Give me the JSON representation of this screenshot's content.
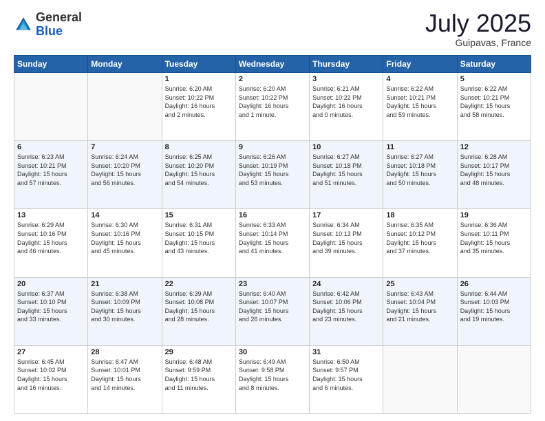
{
  "header": {
    "logo_general": "General",
    "logo_blue": "Blue",
    "month": "July 2025",
    "location": "Guipavas, France"
  },
  "weekdays": [
    "Sunday",
    "Monday",
    "Tuesday",
    "Wednesday",
    "Thursday",
    "Friday",
    "Saturday"
  ],
  "weeks": [
    [
      {
        "day": "",
        "info": ""
      },
      {
        "day": "",
        "info": ""
      },
      {
        "day": "1",
        "info": "Sunrise: 6:20 AM\nSunset: 10:22 PM\nDaylight: 16 hours\nand 2 minutes."
      },
      {
        "day": "2",
        "info": "Sunrise: 6:20 AM\nSunset: 10:22 PM\nDaylight: 16 hours\nand 1 minute."
      },
      {
        "day": "3",
        "info": "Sunrise: 6:21 AM\nSunset: 10:22 PM\nDaylight: 16 hours\nand 0 minutes."
      },
      {
        "day": "4",
        "info": "Sunrise: 6:22 AM\nSunset: 10:21 PM\nDaylight: 15 hours\nand 59 minutes."
      },
      {
        "day": "5",
        "info": "Sunrise: 6:22 AM\nSunset: 10:21 PM\nDaylight: 15 hours\nand 58 minutes."
      }
    ],
    [
      {
        "day": "6",
        "info": "Sunrise: 6:23 AM\nSunset: 10:21 PM\nDaylight: 15 hours\nand 57 minutes."
      },
      {
        "day": "7",
        "info": "Sunrise: 6:24 AM\nSunset: 10:20 PM\nDaylight: 15 hours\nand 56 minutes."
      },
      {
        "day": "8",
        "info": "Sunrise: 6:25 AM\nSunset: 10:20 PM\nDaylight: 15 hours\nand 54 minutes."
      },
      {
        "day": "9",
        "info": "Sunrise: 6:26 AM\nSunset: 10:19 PM\nDaylight: 15 hours\nand 53 minutes."
      },
      {
        "day": "10",
        "info": "Sunrise: 6:27 AM\nSunset: 10:18 PM\nDaylight: 15 hours\nand 51 minutes."
      },
      {
        "day": "11",
        "info": "Sunrise: 6:27 AM\nSunset: 10:18 PM\nDaylight: 15 hours\nand 50 minutes."
      },
      {
        "day": "12",
        "info": "Sunrise: 6:28 AM\nSunset: 10:17 PM\nDaylight: 15 hours\nand 48 minutes."
      }
    ],
    [
      {
        "day": "13",
        "info": "Sunrise: 6:29 AM\nSunset: 10:16 PM\nDaylight: 15 hours\nand 46 minutes."
      },
      {
        "day": "14",
        "info": "Sunrise: 6:30 AM\nSunset: 10:16 PM\nDaylight: 15 hours\nand 45 minutes."
      },
      {
        "day": "15",
        "info": "Sunrise: 6:31 AM\nSunset: 10:15 PM\nDaylight: 15 hours\nand 43 minutes."
      },
      {
        "day": "16",
        "info": "Sunrise: 6:33 AM\nSunset: 10:14 PM\nDaylight: 15 hours\nand 41 minutes."
      },
      {
        "day": "17",
        "info": "Sunrise: 6:34 AM\nSunset: 10:13 PM\nDaylight: 15 hours\nand 39 minutes."
      },
      {
        "day": "18",
        "info": "Sunrise: 6:35 AM\nSunset: 10:12 PM\nDaylight: 15 hours\nand 37 minutes."
      },
      {
        "day": "19",
        "info": "Sunrise: 6:36 AM\nSunset: 10:11 PM\nDaylight: 15 hours\nand 35 minutes."
      }
    ],
    [
      {
        "day": "20",
        "info": "Sunrise: 6:37 AM\nSunset: 10:10 PM\nDaylight: 15 hours\nand 33 minutes."
      },
      {
        "day": "21",
        "info": "Sunrise: 6:38 AM\nSunset: 10:09 PM\nDaylight: 15 hours\nand 30 minutes."
      },
      {
        "day": "22",
        "info": "Sunrise: 6:39 AM\nSunset: 10:08 PM\nDaylight: 15 hours\nand 28 minutes."
      },
      {
        "day": "23",
        "info": "Sunrise: 6:40 AM\nSunset: 10:07 PM\nDaylight: 15 hours\nand 26 minutes."
      },
      {
        "day": "24",
        "info": "Sunrise: 6:42 AM\nSunset: 10:06 PM\nDaylight: 15 hours\nand 23 minutes."
      },
      {
        "day": "25",
        "info": "Sunrise: 6:43 AM\nSunset: 10:04 PM\nDaylight: 15 hours\nand 21 minutes."
      },
      {
        "day": "26",
        "info": "Sunrise: 6:44 AM\nSunset: 10:03 PM\nDaylight: 15 hours\nand 19 minutes."
      }
    ],
    [
      {
        "day": "27",
        "info": "Sunrise: 6:45 AM\nSunset: 10:02 PM\nDaylight: 15 hours\nand 16 minutes."
      },
      {
        "day": "28",
        "info": "Sunrise: 6:47 AM\nSunset: 10:01 PM\nDaylight: 15 hours\nand 14 minutes."
      },
      {
        "day": "29",
        "info": "Sunrise: 6:48 AM\nSunset: 9:59 PM\nDaylight: 15 hours\nand 11 minutes."
      },
      {
        "day": "30",
        "info": "Sunrise: 6:49 AM\nSunset: 9:58 PM\nDaylight: 15 hours\nand 8 minutes."
      },
      {
        "day": "31",
        "info": "Sunrise: 6:50 AM\nSunset: 9:57 PM\nDaylight: 15 hours\nand 6 minutes."
      },
      {
        "day": "",
        "info": ""
      },
      {
        "day": "",
        "info": ""
      }
    ]
  ]
}
